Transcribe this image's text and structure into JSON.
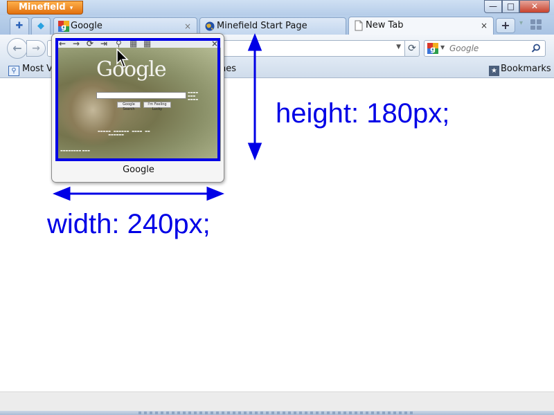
{
  "app": {
    "menu_button_label": "Minefield",
    "menu_arrow": "▾"
  },
  "window_controls": {
    "minimize_glyph": "—",
    "maximize_glyph": "□",
    "close_glyph": "✕"
  },
  "tabs": [
    {
      "title": "Google",
      "icon": "google-favicon",
      "close": "×",
      "selected": false
    },
    {
      "title": "Minefield Start Page",
      "icon": "globe-icon",
      "close": "",
      "selected": false
    },
    {
      "title": "New Tab",
      "icon": "page-icon",
      "close": "×",
      "selected": true
    }
  ],
  "app_tabs": [
    {
      "icon": "puzzle-icon",
      "glyph": "✚"
    },
    {
      "icon": "twitter-bird-icon",
      "glyph": "◆"
    }
  ],
  "new_tab_glyph": "+",
  "navigation": {
    "back_glyph": "←",
    "forward_glyph": "→",
    "reload_glyph": "⟳",
    "url_value": "",
    "url_dropmarker": "▼"
  },
  "search": {
    "placeholder": "Google",
    "engine_icon": "google-g-icon",
    "go_glyph": "🔍"
  },
  "bookmarks_bar": {
    "most_visited_label": "Most Vi",
    "partial_label": "nes",
    "bookmarks_label": "Bookmarks",
    "bookmarks_glyph": "★"
  },
  "tab_preview": {
    "label": "Google",
    "toolbar_glyphs": [
      "←",
      "→",
      "⟳",
      "⇥",
      "⚲",
      "▦",
      "▦",
      "×"
    ],
    "thumbnail": {
      "logo": "Google",
      "button_search": "Google Search",
      "button_lucky": "I'm Feeling Lucky"
    }
  },
  "annotations": {
    "height_text": "height: 180px;",
    "width_text": "width: 240px;",
    "color": "#0000e6"
  },
  "colors": {
    "app_button": "#e1700f",
    "frame_blue": "#b6cde9",
    "annotation_blue": "#0000e6"
  }
}
